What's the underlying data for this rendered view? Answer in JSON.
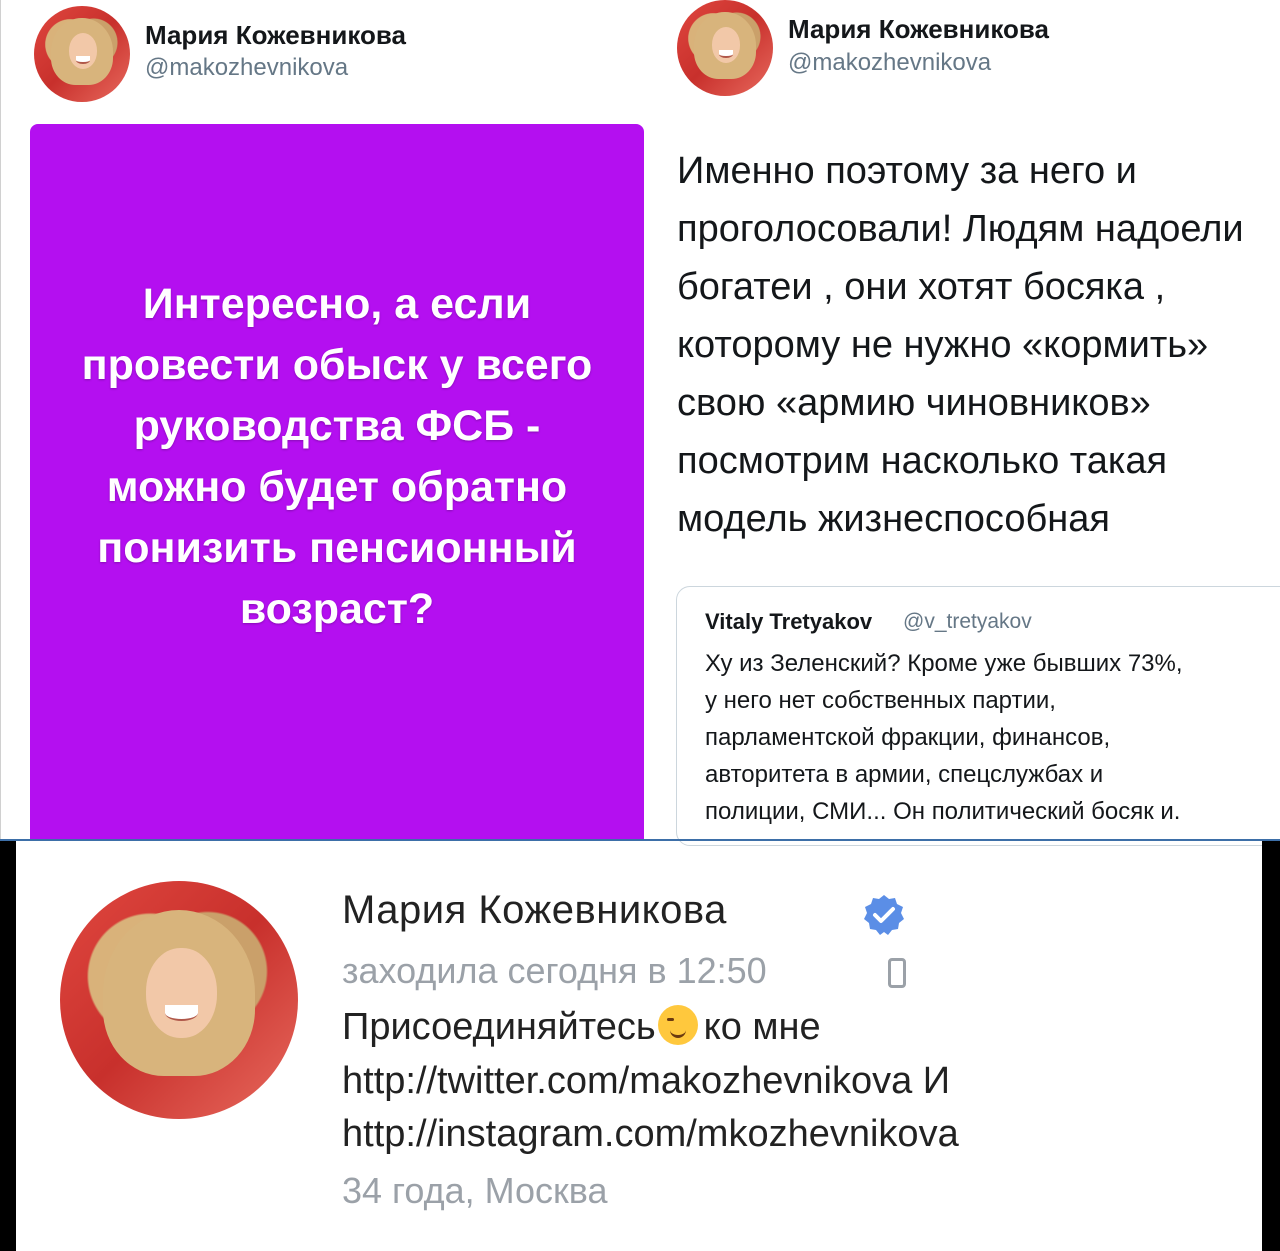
{
  "tweet_left": {
    "author_name": "Мария Кожевникова",
    "author_handle": "@makozhevnikova",
    "image_text": "Интересно, а если провести обыск у всего руководства ФСБ - можно будет обратно понизить пенсионный возраст?",
    "image_bg_color": "#b40ff0"
  },
  "tweet_right": {
    "author_name": "Мария Кожевникова",
    "author_handle": "@makozhevnikova",
    "text": "Именно поэтому за него и проголосовали! Людям надоели богатеи , они хотят босяка , которому не нужно «кормить» свою «армию чиновников» посмотрим насколько такая модель жизнеспособная",
    "quote": {
      "author_name": "Vitaly Tretyakov",
      "author_handle": "@v_tretyakov",
      "text": "Ху из Зеленский? Кроме уже бывших 73%,\nу него нет собственных партии,\nпарламентской фракции, финансов,\nавторитета в армии, спецслужбах и\nполиции, СМИ... Он политический босяк и."
    }
  },
  "profile": {
    "name": "Мария Кожевникова",
    "verified_icon": "verified-badge-icon",
    "last_seen": "заходила сегодня в 12:50",
    "device_icon": "phone-icon",
    "status_before": "Присоединяйтесь",
    "status_emoji": "winking-face-icon",
    "status_after": "ко мне",
    "link_1": "http://twitter.com/makozhevnikova И",
    "link_2": "http://instagram.com/mkozhevnikova",
    "age_city": "34 года, Москва"
  }
}
